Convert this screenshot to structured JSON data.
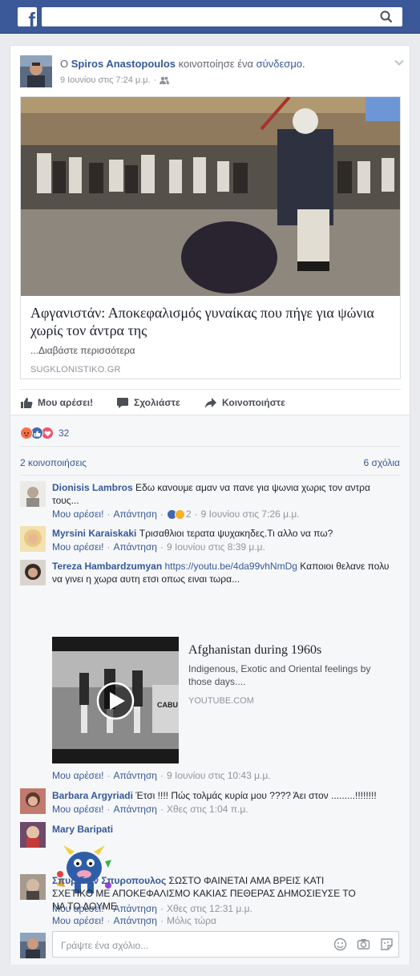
{
  "topbar": {
    "logo": "f",
    "search_placeholder": ""
  },
  "post": {
    "author": "Spiros Anastopoulos",
    "prefix": "Ο",
    "action": "κοινοποίησε ένα",
    "link_word": "σύνδεσμο.",
    "time": "9 Ιουνίου στις 7:24 μ.μ.",
    "separator": "·",
    "link": {
      "title": "Αφγανιστάν: Αποκεφαλισμός γυναίκας που πήγε για ψώνια χωρίς τον άντρα της",
      "description": "...Διαβάστε περισσότερα",
      "source": "SUGKLONISTIKO.GR"
    },
    "actions": {
      "like": "Μου αρέσει!",
      "comment": "Σχολιάστε",
      "share": "Κοινοποιήστε"
    },
    "reactions_count": "32",
    "shares": "2 κοινοποιήσεις",
    "comments_count": "6 σχόλια"
  },
  "meta_labels": {
    "like": "Μου αρέσει!",
    "reply": "Απάντηση",
    "dot": "·"
  },
  "comments": [
    {
      "name": "Dionisis Lambros",
      "text": "Εδω κανουμε αμαν να πανε για ψωνια χωρις τον αντρα τους...",
      "reactions": "2",
      "time": "9 Ιουνίου στις 7:26 μ.μ."
    },
    {
      "name": "Myrsini Karaiskaki",
      "text": "Τρισαθλιοι τερατα ψυχακηδες.Τι αλλο να πω?",
      "time": "9 Ιουνίου στις 8:39 μ.μ."
    },
    {
      "name": "Tereza Hambardzumyan",
      "url": "https://youtu.be/4da99vhNmDg",
      "text": "Καποιοι θελανε πολυ να γινει η χωρα αυτη ετσι οπως ειναι τωρα...",
      "time": "9 Ιουνίου στις 10:43 μ.μ.",
      "video": {
        "title": "Afghanistan during 1960s",
        "description": "Indigenous, Exotic and Oriental feelings by those days....",
        "source": "YOUTUBE.COM",
        "thumb_text": "CABU"
      }
    },
    {
      "name": "Barbara Argyriadi",
      "text": "Έτσι !!!! Πώς τολμάς κυρία μου ???? Άει στον .........!!!!!!!!",
      "time": "Χθες στις 1:04 π.μ."
    },
    {
      "name": "Mary Baripati",
      "text": "",
      "time": "Χθες στις 12:31 μ.μ."
    },
    {
      "name": "Σπυριδων Σπυροπουλος",
      "text": "ΣΩΣΤΟ ΦΑΙΝΕΤΑΙ ΑΜΑ ΒΡΕΙΣ ΚΑΤΙ ΣΧΕΤΙΚΟ ΜΕ ΑΠΟΚΕΦΑΛΙΣΜΟ ΚΑΚΙΑΣ ΠΕΘΕΡΑΣ ΔΗΜΟΣΙΕΥΣΕ ΤΟ ΝΑ ΤΟ ΔΟΥΜΕ",
      "time": "Μόλις τώρα"
    }
  ],
  "reply": {
    "placeholder": "Γράψτε ένα σχόλιο..."
  },
  "colors": {
    "brand": "#3b5998",
    "link": "#365899",
    "meta": "#90949c"
  }
}
